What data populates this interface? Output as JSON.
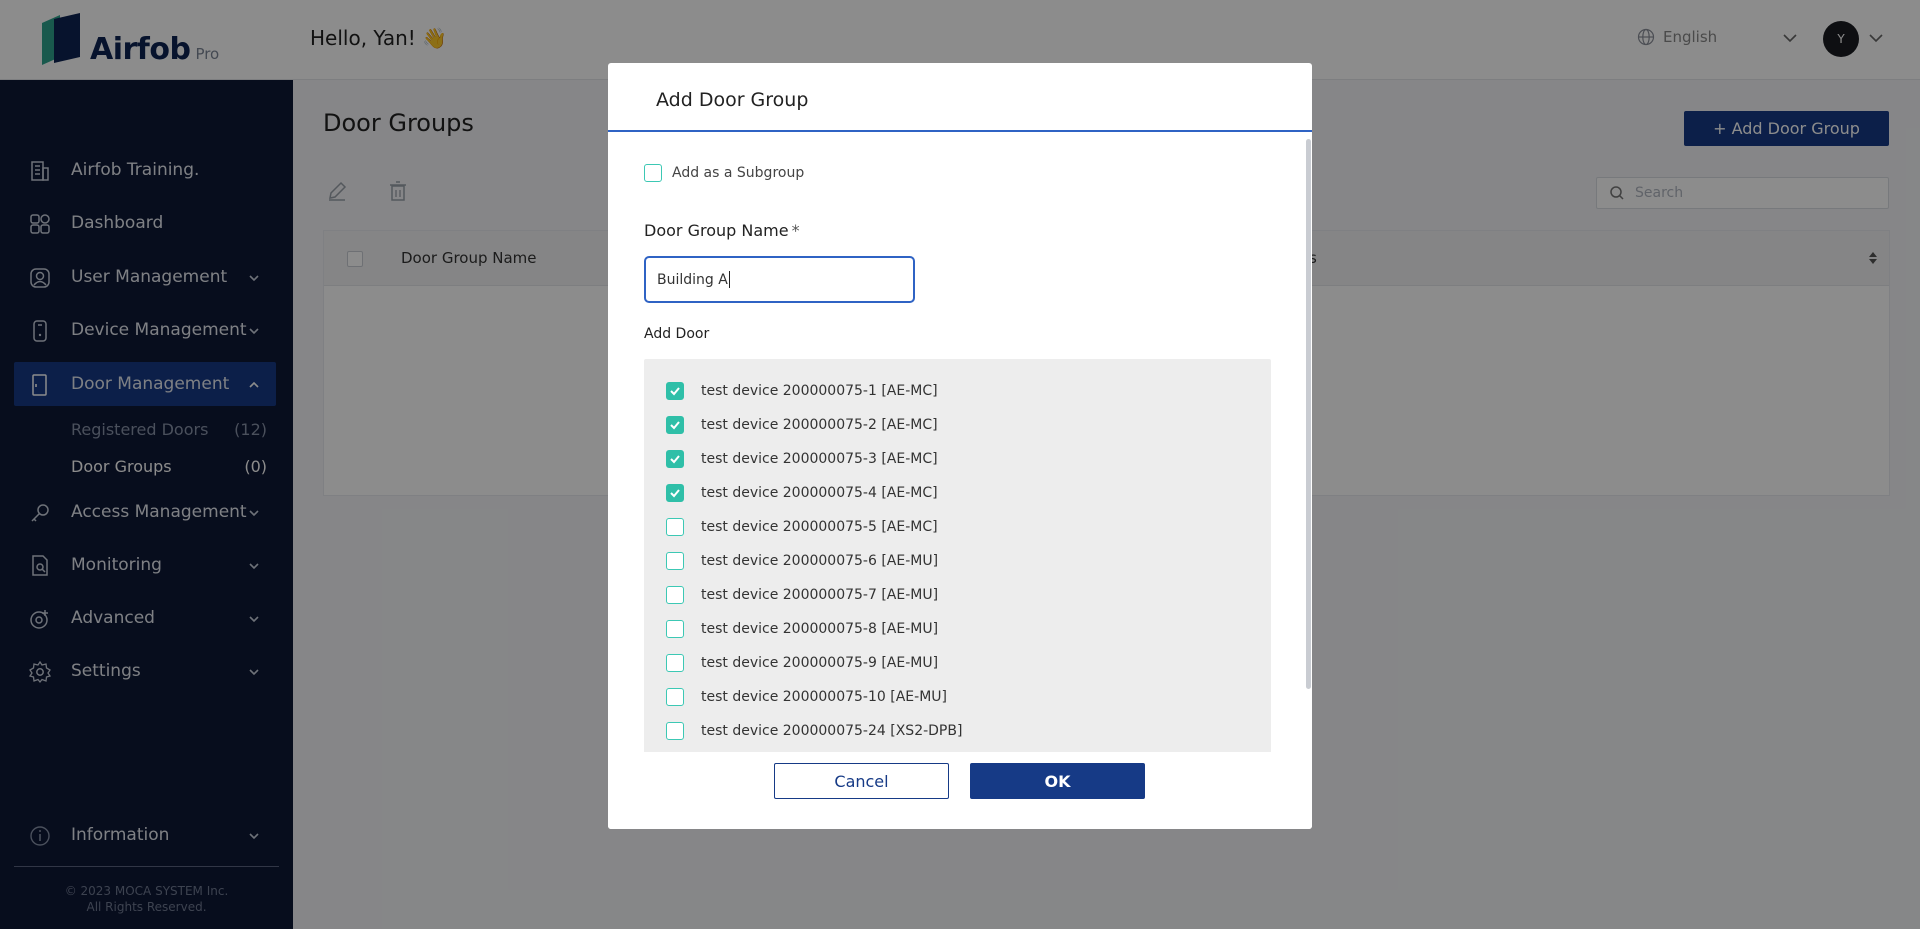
{
  "header": {
    "brand": "Airfob",
    "brand_suffix": "Pro",
    "greeting": "Hello, Yan! 👋",
    "language": "English",
    "avatar_initial": "Y"
  },
  "sidebar": {
    "items": [
      {
        "label": "Airfob Training.",
        "icon": "building-icon"
      },
      {
        "label": "Dashboard",
        "icon": "dashboard-icon"
      },
      {
        "label": "User Management",
        "icon": "user-icon"
      },
      {
        "label": "Device Management",
        "icon": "device-icon"
      },
      {
        "label": "Door Management",
        "icon": "door-icon"
      },
      {
        "label": "Access Management",
        "icon": "key-icon"
      },
      {
        "label": "Monitoring",
        "icon": "monitor-icon"
      },
      {
        "label": "Advanced",
        "icon": "advanced-icon"
      },
      {
        "label": "Settings",
        "icon": "gear-icon"
      },
      {
        "label": "Information",
        "icon": "info-icon"
      }
    ],
    "door_submenu": [
      {
        "label": "Registered Doors",
        "count": "(12)"
      },
      {
        "label": "Door Groups",
        "count": "(0)"
      }
    ],
    "copyright_line1": "© 2023 MOCA SYSTEM Inc.",
    "copyright_line2": "All Rights Reserved."
  },
  "main": {
    "title": "Door Groups",
    "add_button": "+ Add Door Group",
    "search_placeholder": "Search",
    "table": {
      "col_name": "Door Group Name",
      "col_partial": "s"
    }
  },
  "modal": {
    "title": "Add Door Group",
    "subgroup_label": "Add as a Subgroup",
    "name_label": "Door Group Name",
    "required_mark": "*",
    "name_value": "Building A",
    "add_door_label": "Add Door",
    "doors": [
      {
        "label": "test device 200000075-1 [AE-MC]",
        "checked": true
      },
      {
        "label": "test device 200000075-2 [AE-MC]",
        "checked": true
      },
      {
        "label": "test device 200000075-3 [AE-MC]",
        "checked": true
      },
      {
        "label": "test device 200000075-4 [AE-MC]",
        "checked": true
      },
      {
        "label": "test device 200000075-5 [AE-MC]",
        "checked": false
      },
      {
        "label": "test device 200000075-6 [AE-MU]",
        "checked": false
      },
      {
        "label": "test device 200000075-7 [AE-MU]",
        "checked": false
      },
      {
        "label": "test device 200000075-8 [AE-MU]",
        "checked": false
      },
      {
        "label": "test device 200000075-9 [AE-MU]",
        "checked": false
      },
      {
        "label": "test device 200000075-10 [AE-MU]",
        "checked": false
      },
      {
        "label": "test device 200000075-24 [XS2-DPB]",
        "checked": false
      }
    ],
    "cancel_label": "Cancel",
    "ok_label": "OK"
  },
  "colors": {
    "sidebar_bg": "#0e1836",
    "primary": "#163a86",
    "checkbox": "#2fbfa8"
  }
}
